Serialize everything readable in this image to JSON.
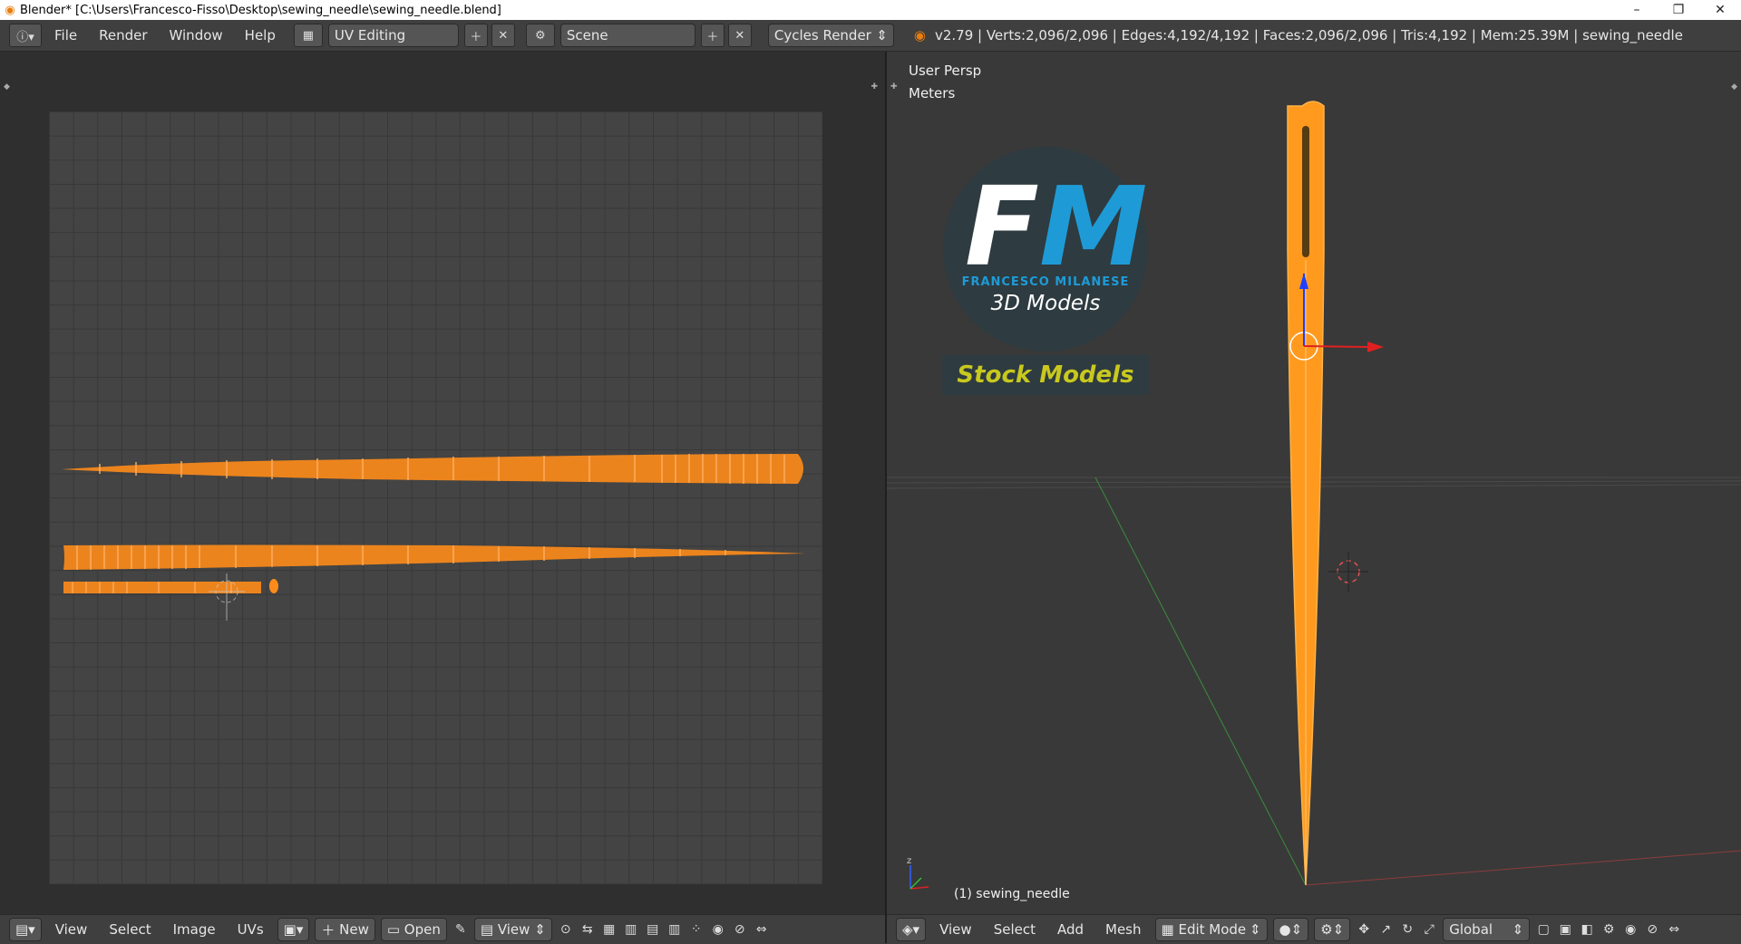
{
  "window": {
    "title": "Blender* [C:\\Users\\Francesco-Fisso\\Desktop\\sewing_needle\\sewing_needle.blend]",
    "minimize": "–",
    "maximize": "❐",
    "close": "✕"
  },
  "infobar": {
    "menus": [
      "File",
      "Render",
      "Window",
      "Help"
    ],
    "screen_layout": "UV Editing",
    "scene": "Scene",
    "render_engine": "Cycles Render",
    "stats": "v2.79 | Verts:2,096/2,096 | Edges:4,192/4,192 | Faces:2,096/2,096 | Tris:4,192 | Mem:25.39M | sewing_needle"
  },
  "viewport": {
    "view_name": "User Persp",
    "units": "Meters",
    "object_label": "(1) sewing_needle"
  },
  "watermark": {
    "letter_f": "F",
    "letter_m": "M",
    "name": "FRANCESCO MILANESE",
    "subtitle": "3D Models",
    "badge": "Stock Models"
  },
  "uv_footer": {
    "menus": [
      "View",
      "Select",
      "Image",
      "UVs"
    ],
    "new_label": "New",
    "open_label": "Open",
    "view_label": "View"
  },
  "viewport_footer": {
    "menus": [
      "View",
      "Select",
      "Add",
      "Mesh"
    ],
    "mode": "Edit Mode",
    "orientation": "Global"
  },
  "colors": {
    "accent": "#e87d0d",
    "mesh": "#ff8c1a",
    "logo_blue": "#1e9bd7",
    "logo_yellow": "#c8c81e"
  }
}
